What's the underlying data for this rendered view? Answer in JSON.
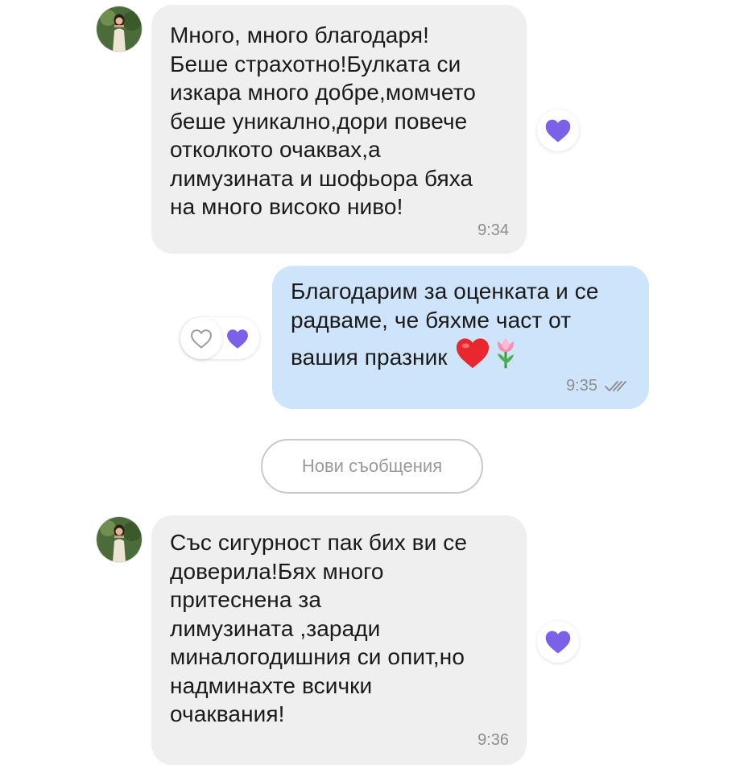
{
  "colors": {
    "incoming_bubble": "#efefef",
    "outgoing_bubble": "#cde4fb",
    "reaction_heart": "#7b61e8",
    "divider_border": "#c9c9c9"
  },
  "messages": [
    {
      "direction": "incoming",
      "text": "Много, много благодаря!\nБеше страхотно!Булката си\nизкара много добре,момчето\nбеше уникално,дори повече\nотколкото очаквах,а\nлимузината и шофьора бяха\nна много високо ниво!",
      "time": "9:34",
      "reaction": "purple-heart"
    },
    {
      "direction": "outgoing",
      "text": "Благодарим за оценката и се\nрадваме, че бяхме част от\nвашия празник",
      "emojis": [
        "red-heart-emoji",
        "tulip-emoji"
      ],
      "time": "9:35",
      "status_icon": "double-check-icon",
      "reactions": [
        "add-reaction-heart-outline",
        "purple-heart"
      ]
    },
    {
      "direction": "incoming",
      "text": "Със сигурност пак бих ви се\nдоверила!Бях много\nпритеснена за\nлимузината ,заради\nминалогодишния си опит,но\nнадминахте всички\nочаквания!",
      "time": "9:36",
      "reaction": "purple-heart"
    }
  ],
  "divider": {
    "label": "Нови съобщения"
  }
}
